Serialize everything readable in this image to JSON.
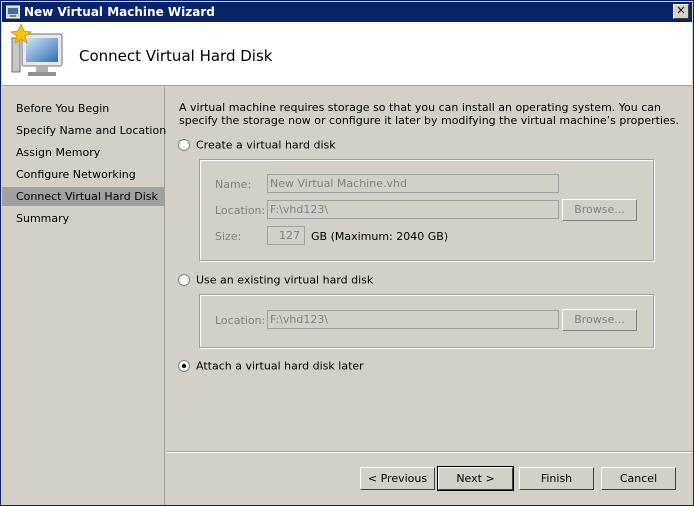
{
  "window": {
    "title": "New Virtual Machine Wizard",
    "close_glyph": "✕"
  },
  "header": {
    "title": "Connect Virtual Hard Disk"
  },
  "sidebar": {
    "items": [
      {
        "label": "Before You Begin"
      },
      {
        "label": "Specify Name and Location"
      },
      {
        "label": "Assign Memory"
      },
      {
        "label": "Configure Networking"
      },
      {
        "label": "Connect Virtual Hard Disk",
        "active": true
      },
      {
        "label": "Summary"
      }
    ]
  },
  "main": {
    "description": "A virtual machine requires storage so that you can install an operating system. You can specify the storage now or configure it later by modifying the virtual machine’s properties.",
    "option_create": {
      "label": "Create a virtual hard disk",
      "selected": false,
      "name_label": "Name:",
      "name_value": "New Virtual Machine.vhd",
      "location_label": "Location:",
      "location_value": "F:\\vhd123\\",
      "browse_label": "Browse...",
      "size_label": "Size:",
      "size_value": "127",
      "size_suffix": "GB (Maximum: 2040 GB)"
    },
    "option_existing": {
      "label": "Use an existing virtual hard disk",
      "selected": false,
      "location_label": "Location:",
      "location_value": "F:\\vhd123\\",
      "browse_label": "Browse..."
    },
    "option_later": {
      "label": "Attach a virtual hard disk later",
      "selected": true
    }
  },
  "footer": {
    "previous_label": "< Previous",
    "next_label": "Next >",
    "finish_label": "Finish",
    "cancel_label": "Cancel"
  }
}
